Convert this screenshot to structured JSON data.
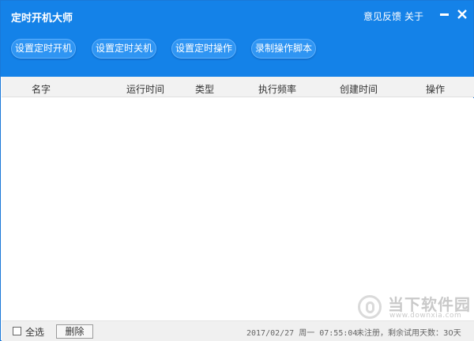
{
  "app": {
    "title": "定时开机大师",
    "feedback_label": "意见反馈",
    "about_label": "关于"
  },
  "toolbar": {
    "buttons": [
      {
        "label": "设置定时开机"
      },
      {
        "label": "设置定时关机"
      },
      {
        "label": "设置定时操作"
      },
      {
        "label": "录制操作脚本"
      }
    ]
  },
  "table": {
    "columns": [
      "名字",
      "运行时间",
      "类型",
      "执行频率",
      "创建时间",
      "操作"
    ],
    "rows": []
  },
  "footer": {
    "select_all_label": "全选",
    "select_all_checked": false,
    "delete_label": "删除",
    "datetime": "2017/02/27 周一 07:55:04",
    "registration_status": "未注册，剩余试用天数：30天"
  },
  "watermark": {
    "name": "当下软件园",
    "url": "www.downxia.com"
  },
  "colors": {
    "accent": "#1482e8",
    "button": "#2f95f3",
    "header_bg": "#f2f2f2"
  },
  "icons": {
    "minimize": "minimize-icon",
    "close": "close-icon",
    "checkbox": "checkbox-icon",
    "watermark_logo": "downxia-logo-icon"
  }
}
